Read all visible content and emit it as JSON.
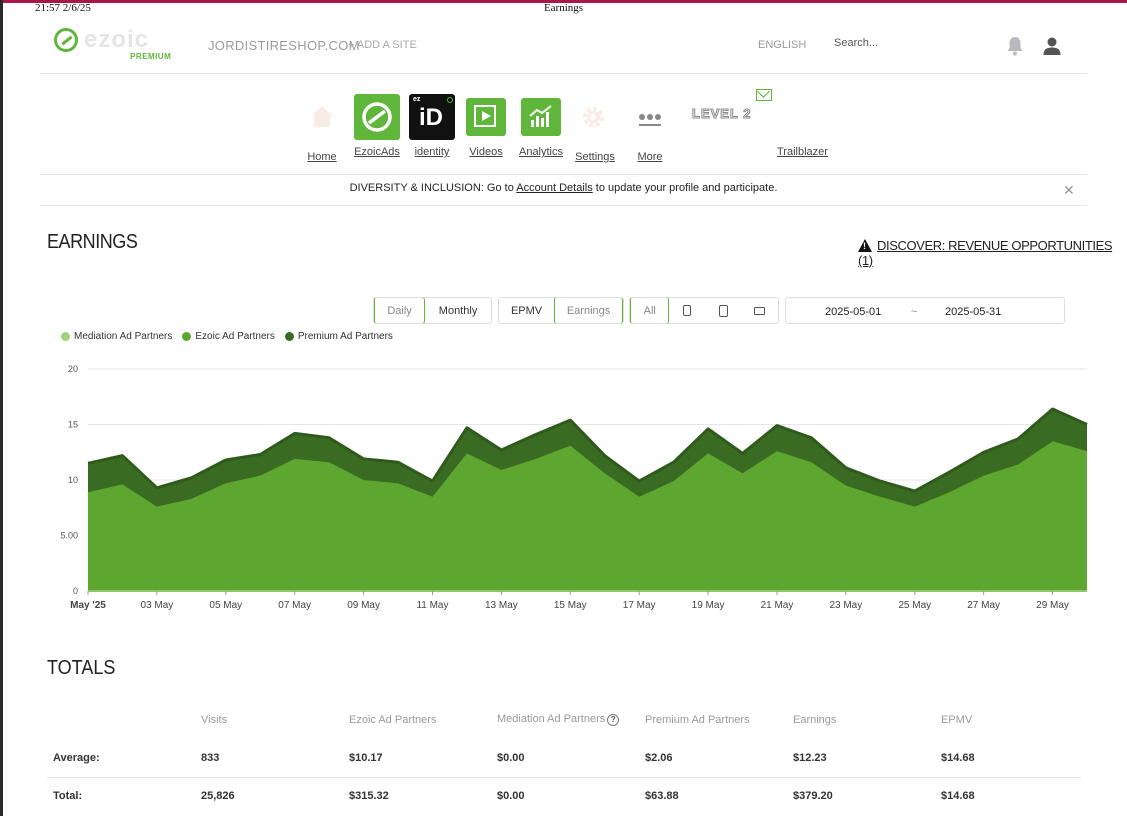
{
  "print": {
    "timestamp": "21:57 2/6/25",
    "title": "Earnings"
  },
  "header": {
    "logo_text": "ezoic",
    "logo_sub": "PREMIUM",
    "site": "JORDISTIRESHOP.COM",
    "add_site": "+ ADD A SITE",
    "language": "ENGLISH",
    "search_placeholder": "Search..."
  },
  "nav": {
    "items": [
      {
        "label": "Home",
        "icon": "home-icon"
      },
      {
        "label": "EzoicAds",
        "icon": "ezoic-ads-icon",
        "color": "#5fb63a"
      },
      {
        "label": "identity",
        "icon": "ezoic-id-icon",
        "tile_text": "iD",
        "tile_small": "ez",
        "color": "#111111"
      },
      {
        "label": "Videos",
        "icon": "video-play-icon",
        "color": "#5fb63a"
      },
      {
        "label": "Analytics",
        "icon": "analytics-chart-icon",
        "color": "#5fb63a"
      },
      {
        "label": "Settings",
        "icon": "gear-icon"
      },
      {
        "label": "More",
        "icon": "more-dots-icon"
      }
    ],
    "level": "LEVEL 2",
    "trailblazer": "Trailblazer"
  },
  "banner": {
    "prefix": "DIVERSITY & INCLUSION: Go to",
    "link": "Account Details",
    "suffix": "to update your profile and participate."
  },
  "earnings": {
    "title": "EARNINGS",
    "discover": "DISCOVER: REVENUE OPPORTUNITIES (1)",
    "period_tabs": [
      "Daily",
      "Monthly"
    ],
    "metric_tabs": [
      "EPMV",
      "Earnings"
    ],
    "device_tabs": [
      "All"
    ],
    "date_start": "2025-05-01",
    "date_sep": "~",
    "date_end": "2025-05-31"
  },
  "chart_data": {
    "type": "area",
    "stacked": true,
    "x": [
      "May '25",
      "02 May",
      "03 May",
      "04 May",
      "05 May",
      "06 May",
      "07 May",
      "08 May",
      "09 May",
      "10 May",
      "11 May",
      "12 May",
      "13 May",
      "14 May",
      "15 May",
      "16 May",
      "17 May",
      "18 May",
      "19 May",
      "20 May",
      "21 May",
      "22 May",
      "23 May",
      "24 May",
      "25 May",
      "26 May",
      "27 May",
      "28 May",
      "29 May",
      "30 May"
    ],
    "x_tick_labels": [
      "May '25",
      "03 May",
      "05 May",
      "07 May",
      "09 May",
      "11 May",
      "13 May",
      "15 May",
      "17 May",
      "19 May",
      "21 May",
      "23 May",
      "25 May",
      "27 May",
      "29 May"
    ],
    "y_ticks": [
      "0",
      "5.00",
      "10",
      "15",
      "20"
    ],
    "ylim": [
      0,
      20
    ],
    "grid": true,
    "legend_position": "top-left",
    "series": [
      {
        "name": "Mediation Ad Partners",
        "color": "#9ed27d",
        "values": [
          0,
          0,
          0,
          0,
          0,
          0,
          0,
          0,
          0,
          0,
          0,
          0,
          0,
          0,
          0,
          0,
          0,
          0,
          0,
          0,
          0,
          0,
          0,
          0,
          0,
          0,
          0,
          0,
          0,
          0
        ]
      },
      {
        "name": "Ezoic Ad Partners",
        "color": "#5da62f",
        "values": [
          8.9,
          9.6,
          7.6,
          8.3,
          9.7,
          10.4,
          11.9,
          11.6,
          10.0,
          9.7,
          8.5,
          12.4,
          10.9,
          11.9,
          13.1,
          10.6,
          8.5,
          9.9,
          12.4,
          10.6,
          12.6,
          11.6,
          9.5,
          8.5,
          7.6,
          8.9,
          10.4,
          11.4,
          13.5,
          12.6
        ]
      },
      {
        "name": "Premium Ad Partners",
        "color": "#3a6b23",
        "values": [
          2.6,
          2.6,
          1.7,
          1.9,
          2.1,
          1.9,
          2.3,
          2.2,
          1.9,
          1.9,
          1.4,
          2.3,
          1.8,
          2.2,
          2.3,
          1.6,
          1.4,
          1.7,
          2.2,
          1.8,
          2.3,
          2.2,
          1.6,
          1.4,
          1.4,
          1.8,
          2.1,
          2.3,
          2.9,
          2.4
        ]
      }
    ]
  },
  "totals": {
    "title": "TOTALS",
    "columns": [
      "",
      "Visits",
      "Ezoic Ad Partners",
      "Mediation Ad Partners",
      "Premium Ad Partners",
      "Earnings",
      "EPMV"
    ],
    "rows": [
      [
        "Average:",
        "833",
        "$10.17",
        "$0.00",
        "$2.06",
        "$12.23",
        "$14.68"
      ],
      [
        "Total:",
        "25,826",
        "$315.32",
        "$0.00",
        "$63.88",
        "$379.20",
        "$14.68"
      ]
    ]
  }
}
